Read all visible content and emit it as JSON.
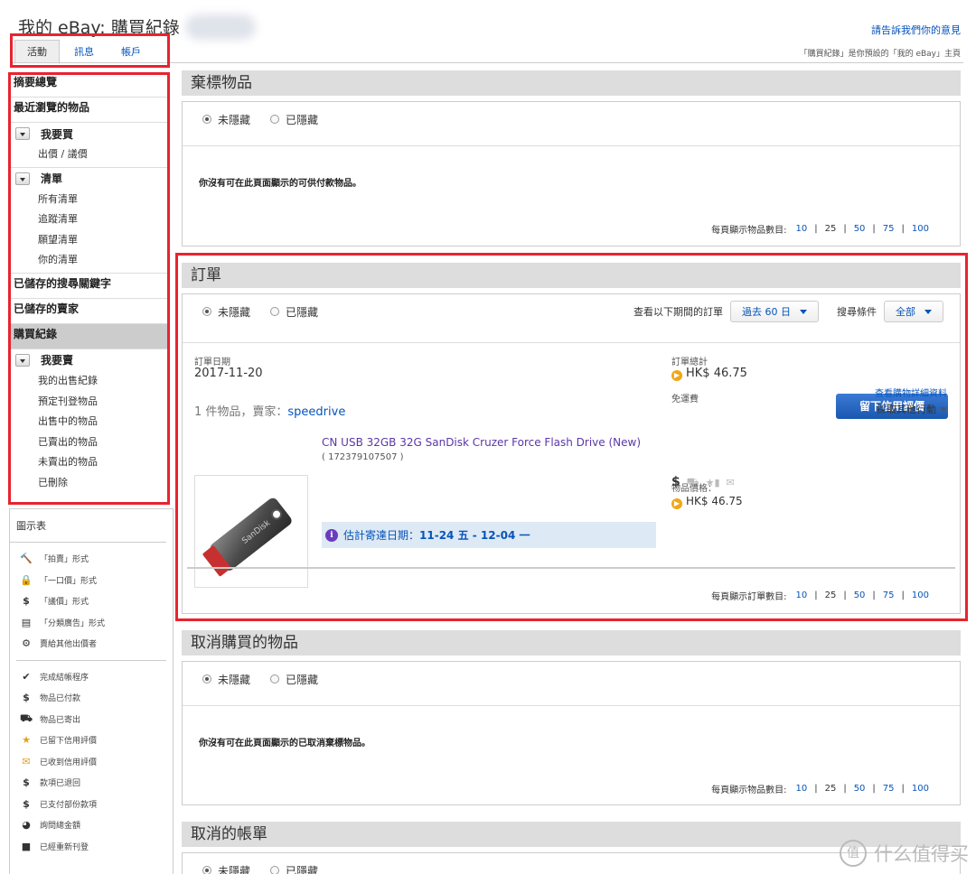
{
  "header": {
    "title": "我的 eBay: 購買紀錄",
    "feedback_link": "請告訴我們你的意見",
    "default_note": "「購買紀錄」是你預設的「我的 eBay」主頁",
    "tabs": [
      {
        "label": "活動",
        "active": true
      },
      {
        "label": "訊息",
        "active": false
      },
      {
        "label": "帳戶",
        "active": false
      }
    ]
  },
  "sidebar": {
    "summary": "摘要總覽",
    "recently_viewed": "最近瀏覽的物品",
    "buy_group": {
      "title": "我要買",
      "items": [
        "出價 / 議價"
      ]
    },
    "list_group": {
      "title": "清單",
      "items": [
        "所有清單",
        "追蹤清單",
        "願望清單",
        "你的清單"
      ]
    },
    "saved_searches": "已儲存的搜尋關鍵字",
    "saved_sellers": "已儲存的賣家",
    "purchase_history": "購買紀錄",
    "sell_group": {
      "title": "我要賣",
      "items": [
        "我的出售紀錄",
        "預定刊登物品",
        "出售中的物品",
        "已賣出的物品",
        "未賣出的物品",
        "已刪除"
      ]
    }
  },
  "legend": {
    "title": "圖示表",
    "formats": [
      {
        "icon": "gavel-icon",
        "glyph": "🔨",
        "label": "「拍賣」形式"
      },
      {
        "icon": "lock-icon",
        "glyph": "🔒",
        "label": "「一口價」形式"
      },
      {
        "icon": "dollar-tag-icon",
        "glyph": "$",
        "label": "「議價」形式"
      },
      {
        "icon": "classified-icon",
        "glyph": "▤",
        "label": "「分類廣告」形式"
      },
      {
        "icon": "gear-icon",
        "glyph": "⚙",
        "label": "賣給其他出價者"
      }
    ],
    "statuses": [
      {
        "icon": "check-icon",
        "glyph": "✔",
        "label": "完成結帳程序"
      },
      {
        "icon": "dollar-icon",
        "glyph": "$",
        "label": "物品已付款"
      },
      {
        "icon": "truck-icon",
        "glyph": "⛟",
        "label": "物品已寄出"
      },
      {
        "icon": "feedback-left-icon",
        "glyph": "★",
        "label": "已留下信用評價"
      },
      {
        "icon": "feedback-received-icon",
        "glyph": "✉",
        "label": "已收到信用評價"
      },
      {
        "icon": "refund-icon",
        "glyph": "$",
        "label": "款項已退回"
      },
      {
        "icon": "partial-payment-icon",
        "glyph": "$",
        "label": "已支付部份款項"
      },
      {
        "icon": "pie-icon",
        "glyph": "◕",
        "label": "詢問總金額"
      },
      {
        "icon": "relist-icon",
        "glyph": "■",
        "label": "已經重新刊登"
      }
    ]
  },
  "filters": {
    "unhidden": "未隱藏",
    "hidden": "已隱藏"
  },
  "pager": {
    "items_label": "每頁顯示物品數目:",
    "orders_label": "每頁顯示訂單數目:",
    "sizes": [
      "10",
      "25",
      "50",
      "75",
      "100"
    ],
    "current": "25"
  },
  "won_section": {
    "title": "棄標物品",
    "empty": "你沒有可在此頁面顯示的可供付款物品。"
  },
  "orders_section": {
    "title": "訂單",
    "period_label": "查看以下期間的訂單",
    "period_value": "過去 60 日",
    "search_label": "搜尋條件",
    "search_value": "全部",
    "order_date_label": "訂單日期",
    "order_date": "2017-11-20",
    "order_total_label": "訂單總計",
    "order_total": "HK$ 46.75",
    "shipping": "免運費",
    "items_seller_prefix": "1 件物品，賣家：",
    "seller": "speedrive",
    "feedback_button": "留下信用評價",
    "details_link": "查看購物詳細資料",
    "more_actions": "採取其他行動",
    "item_title": "CN USB 32GB 32G SanDisk Cruzer Force Flash Drive (New)",
    "item_number": "( 172379107507 )",
    "delivery_label": "估計寄達日期：",
    "delivery_range": "11-24 五 - 12-04 一",
    "price_label": "物品價格：",
    "price": "HK$ 46.75",
    "thumb_brand": "SanDisk"
  },
  "cancelled_section": {
    "title": "取消購買的物品",
    "empty": "你沒有可在此頁面顯示的已取消棄標物品。"
  },
  "cancelled_bills_section": {
    "title": "取消的帳單"
  },
  "watermark": {
    "glyph": "值",
    "text": "什么值得买"
  }
}
